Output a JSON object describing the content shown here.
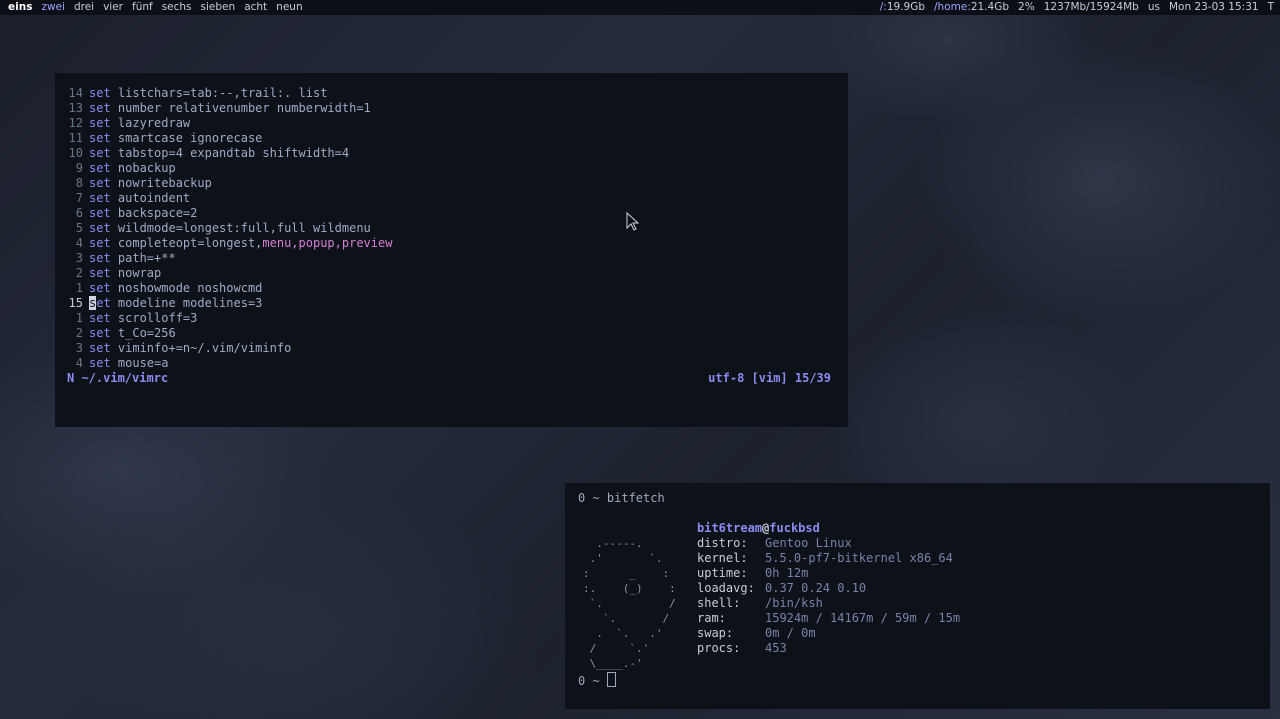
{
  "topbar": {
    "workspaces": [
      "eins",
      "zwei",
      "drei",
      "vier",
      "fünf",
      "sechs",
      "sieben",
      "acht",
      "neun"
    ],
    "active_workspace": "eins",
    "urgent_workspace": "zwei",
    "status": {
      "root_label": "/:",
      "root_size": "19.9Gb",
      "home_label": "/home:",
      "home_size": "21.4Gb",
      "cpu": "2%",
      "mem": "1237Mb/15924Mb",
      "kbd_layout": "us",
      "datetime": "Mon 23-03 15:31",
      "tray_glyph": "T"
    }
  },
  "vim": {
    "lines": [
      {
        "num": "14",
        "kw": "set",
        "text": " listchars=tab:--,trail:. list"
      },
      {
        "num": "13",
        "kw": "set",
        "text": " number relativenumber numberwidth=1"
      },
      {
        "num": "12",
        "kw": "set",
        "text": " lazyredraw"
      },
      {
        "num": "11",
        "kw": "set",
        "text": " smartcase ignorecase"
      },
      {
        "num": "10",
        "kw": "set",
        "text": " tabstop=4 expandtab shiftwidth=4"
      },
      {
        "num": "9",
        "kw": "set",
        "text": " nobackup"
      },
      {
        "num": "8",
        "kw": "set",
        "text": " nowritebackup"
      },
      {
        "num": "7",
        "kw": "set",
        "text": " autoindent"
      },
      {
        "num": "6",
        "kw": "set",
        "text": " backspace=2"
      },
      {
        "num": "5",
        "kw": "set",
        "text": " wildmode=longest:full,full wildmenu"
      },
      {
        "num": "4",
        "kw": "set",
        "text": " completeopt=longest,",
        "pink": "menu,popup,preview"
      },
      {
        "num": "3",
        "kw": "set",
        "text": " path=+**"
      },
      {
        "num": "2",
        "kw": "set",
        "text": " nowrap"
      },
      {
        "num": "1",
        "kw": "set",
        "text": " noshowmode noshowcmd"
      },
      {
        "num": "15",
        "kw": "set",
        "text": " modeline modelines=3",
        "current": true
      },
      {
        "num": "1",
        "kw": "set",
        "text": " scrolloff=3"
      },
      {
        "num": "2",
        "kw": "set",
        "text": " t_Co=256"
      },
      {
        "num": "3",
        "kw": "set",
        "text": " viminfo+=n~/.vim/viminfo"
      },
      {
        "num": "4",
        "kw": "set",
        "text": " mouse=a"
      }
    ],
    "statusline": {
      "mode_file": "N ~/.vim/vimrc",
      "info": "utf-8 [vim] 15/39"
    }
  },
  "terminal": {
    "prompt_command": "0 ~ bitfetch",
    "prompt_idle": "0 ~ ",
    "ascii_art": "  .-----.\n .'       `.\n:      _    :\n:.    (_)    :\n `.          /\n   `.       /\n  .  `.   .'\n /     `.'\n \\____.-'",
    "user": "bit6tream",
    "at": "@",
    "host": "fuckbsd",
    "fields": [
      {
        "key": "distro:",
        "value": "Gentoo Linux"
      },
      {
        "key": "kernel:",
        "value": "5.5.0-pf7-bitkernel x86_64"
      },
      {
        "key": "uptime:",
        "value": "0h 12m"
      },
      {
        "key": "loadavg:",
        "value": "0.37 0.24 0.10"
      },
      {
        "key": "shell:",
        "value": "/bin/ksh"
      },
      {
        "key": "ram:",
        "value": "15924m / 14167m / 59m / 15m"
      },
      {
        "key": "swap:",
        "value": "0m / 0m"
      },
      {
        "key": "procs:",
        "value": "453"
      }
    ]
  },
  "colors": {
    "accent": "#8a8cf0",
    "pink": "#d67fd6",
    "bar_bg": "#0c0f16",
    "window_bg": "#0d1118"
  }
}
